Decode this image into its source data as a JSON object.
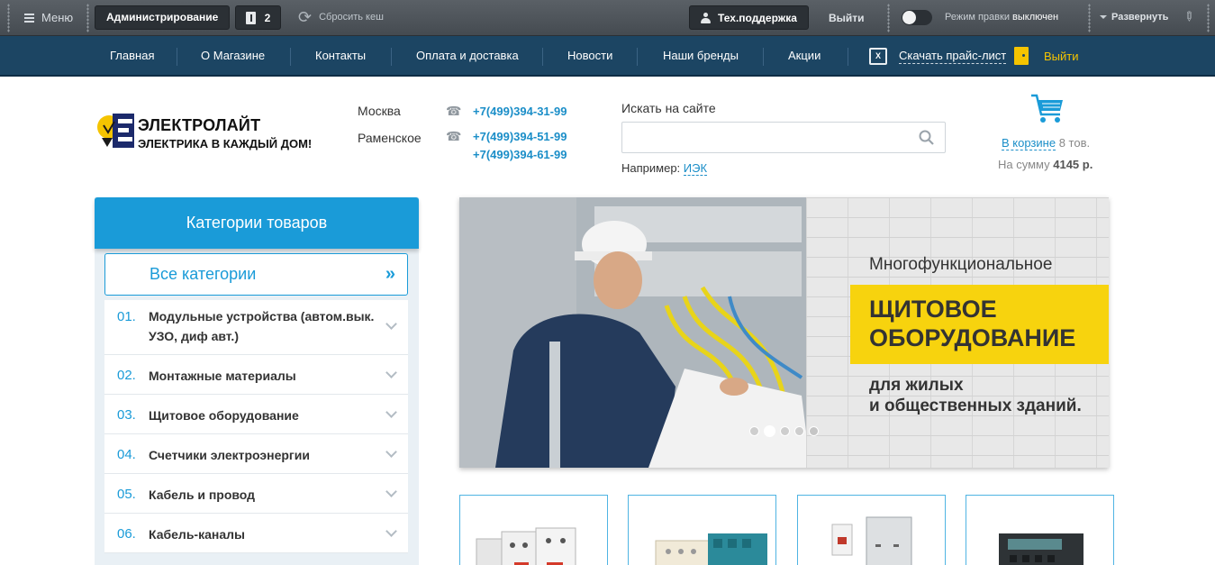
{
  "admin_panel": {
    "menu_label": "Меню",
    "admin_button": "Администрирование",
    "notifications_count": "2",
    "reset_cache": "Сбросить кеш",
    "support_button": "Тех.поддержка",
    "logout": "Выйти",
    "edit_mode_label": "Режим правки",
    "edit_mode_state": "выключен",
    "expand": "Развернуть",
    "edit_mode_on": false
  },
  "top_nav": {
    "items": [
      "Главная",
      "О Магазине",
      "Контакты",
      "Оплата и доставка",
      "Новости",
      "Наши бренды",
      "Акции"
    ],
    "price_list": "Скачать прайс-лист",
    "excel_icon": "excel-icon",
    "logout": "Выйти"
  },
  "header": {
    "logo_name": "ЭЛЕКТРОЛАЙТ",
    "logo_slogan": "ЭЛЕКТРИКА В КАЖДЫЙ ДОМ!",
    "contacts": [
      {
        "city": "Москва",
        "phones": [
          "+7(499)394-31-99"
        ]
      },
      {
        "city": "Раменское",
        "phones": [
          "+7(499)394-51-99",
          "+7(499)394-61-99"
        ]
      }
    ],
    "search": {
      "label": "Искать на сайте",
      "value": "",
      "placeholder": "",
      "example_prefix": "Например:",
      "example_link": "ИЭК"
    },
    "cart": {
      "link": "В корзине",
      "count": "8 тов.",
      "sum_label": "На сумму",
      "sum_value": "4145 р."
    }
  },
  "catalog": {
    "title": "Категории товаров",
    "all_label": "Все категории",
    "all_arrow": "»",
    "items": [
      {
        "num": "01.",
        "name": "Модульные устройства (автом.вык. УЗО, диф авт.)"
      },
      {
        "num": "02.",
        "name": "Монтажные материалы"
      },
      {
        "num": "03.",
        "name": "Щитовое оборудование"
      },
      {
        "num": "04.",
        "name": "Счетчики электроэнергии"
      },
      {
        "num": "05.",
        "name": "Кабель и провод"
      },
      {
        "num": "06.",
        "name": "Кабель-каналы"
      }
    ]
  },
  "banner": {
    "pre_title": "Многофункциональное",
    "title_line1": "ЩИТОВОЕ",
    "title_line2": "ОБОРУДОВАНИЕ",
    "sub_line1": "для жилых",
    "sub_line2": "и общественных зданий.",
    "slides_total": 5,
    "active_slide": 2
  },
  "colors": {
    "accent": "#1a9bd8",
    "nav_bg": "#1c4563",
    "banner_yellow": "#f7d30e",
    "admin_bg": "#4e5459"
  }
}
